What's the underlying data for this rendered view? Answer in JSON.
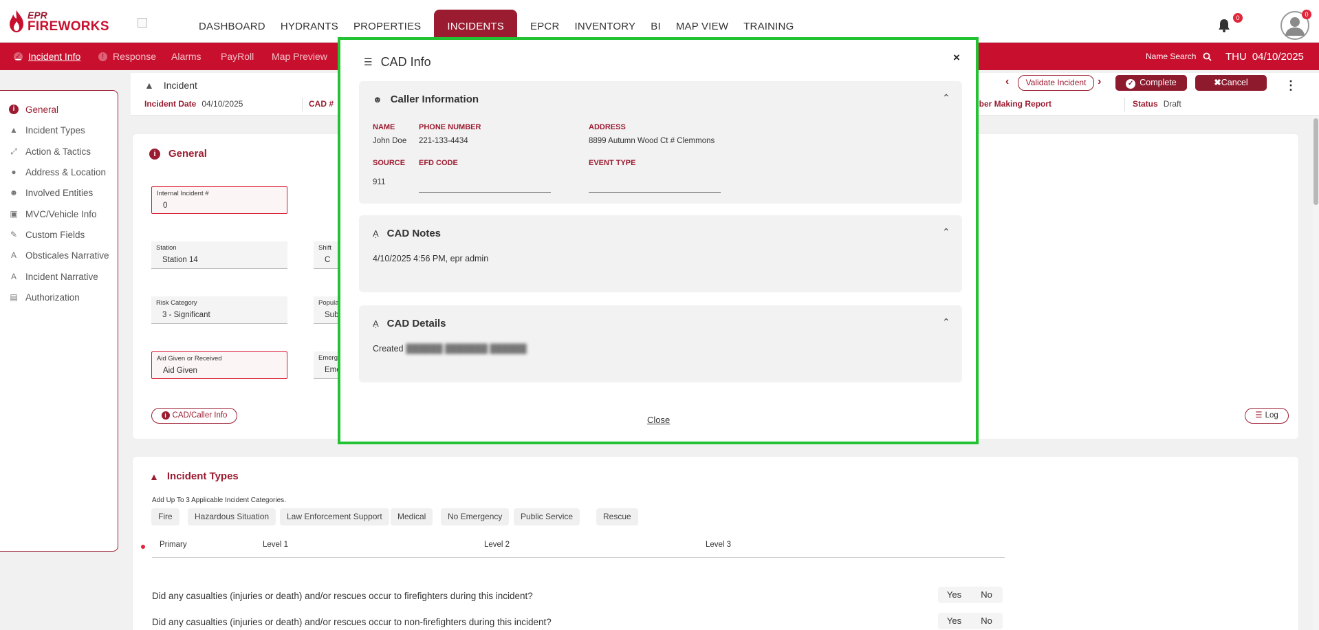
{
  "header": {
    "logo_top": "EPR",
    "logo_bottom": "FIREWORKS",
    "nav": [
      "DASHBOARD",
      "HYDRANTS",
      "PROPERTIES",
      "INCIDENTS",
      "EPCR",
      "INVENTORY",
      "BI",
      "MAP VIEW",
      "TRAINING"
    ],
    "active_nav": "INCIDENTS",
    "notification_count": "0",
    "avatar_badge": "0"
  },
  "subnav": {
    "items": [
      "Incident Info",
      "Response",
      "Alarms",
      "PayRoll",
      "Map Preview"
    ],
    "name_search": "Name Search",
    "day": "THU",
    "date": "04/10/2025"
  },
  "incident": {
    "title": "Incident",
    "date_label": "Incident Date",
    "date_value": "04/10/2025",
    "cad_label": "CAD #",
    "member_label": "mber Making Report",
    "status_label": "Status",
    "status_value": "Draft",
    "validate_label": "Validate Incident",
    "complete_label": "Complete",
    "cancel_label": "Cancel"
  },
  "sidebar": {
    "items": [
      "General",
      "Incident Types",
      "Action & Tactics",
      "Address & Location",
      "Involved Entities",
      "MVC/Vehicle Info",
      "Custom Fields",
      "Obsticales Narrative",
      "Incident Narrative",
      "Authorization"
    ]
  },
  "general": {
    "title": "General",
    "internal_label": "Internal Incident #",
    "internal_value": "0",
    "station_label": "Station",
    "station_value": "Station 14",
    "shift_label": "Shift",
    "shift_value": "C",
    "risk_label": "Risk Category",
    "risk_value": "3 - Significant",
    "popul_label": "Popula",
    "popul_value": "Sub",
    "aid_label": "Aid Given or Received",
    "aid_value": "Aid Given",
    "emerg_label": "Emerg",
    "emerg_value": "Eme",
    "cad_button": "CAD/Caller Info",
    "log_button": "Log"
  },
  "incident_types": {
    "title": "Incident Types",
    "hint": "Add Up To 3 Applicable Incident Categories.",
    "chips": [
      "Fire",
      "Hazardous Situation",
      "Law Enforcement Support",
      "Medical",
      "No Emergency",
      "Public Service",
      "Rescue"
    ],
    "cols": [
      "Primary",
      "Level 1",
      "Level 2",
      "Level 3"
    ],
    "q1": "Did any casualties (injuries or death) and/or rescues occur to firefighters during this incident?",
    "q2": "Did any casualties (injuries or death) and/or rescues occur to non-firefighters during this incident?",
    "yes": "Yes",
    "no": "No"
  },
  "modal": {
    "title": "CAD Info",
    "close_x": "×",
    "caller": {
      "heading": "Caller Information",
      "name_label": "NAME",
      "name_value": "John Doe",
      "phone_label": "PHONE NUMBER",
      "phone_value": "221-133-4434",
      "address_label": "ADDRESS",
      "address_value": "8899 Autumn Wood Ct # Clemmons",
      "source_label": "SOURCE",
      "source_value": "911",
      "efd_label": "EFD CODE",
      "event_label": "EVENT TYPE"
    },
    "notes": {
      "heading": "CAD Notes",
      "text": "4/10/2025 4:56 PM, epr admin"
    },
    "details": {
      "heading": "CAD Details",
      "created_label": "Created",
      "created_blurred": "██████ ███████ ██████"
    },
    "close_link": "Close"
  }
}
